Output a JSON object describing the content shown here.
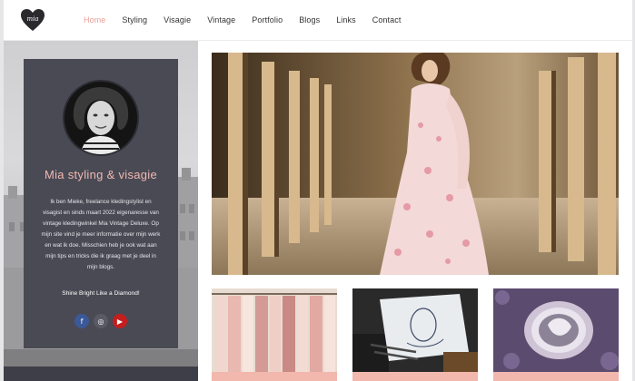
{
  "site": {
    "logo_text": "mia",
    "logo_icon": "heart-logo-icon"
  },
  "nav": {
    "items": [
      {
        "label": "Home",
        "active": true
      },
      {
        "label": "Styling",
        "active": false
      },
      {
        "label": "Visagie",
        "active": false
      },
      {
        "label": "Vintage",
        "active": false
      },
      {
        "label": "Portfolio",
        "active": false
      },
      {
        "label": "Blogs",
        "active": false
      },
      {
        "label": "Links",
        "active": false
      },
      {
        "label": "Contact",
        "active": false
      }
    ]
  },
  "profile": {
    "title": "Mia styling & visagie",
    "bio": "Ik ben Mieke, freelance kledingstylist en visagist en sinds maart 2022 eigenaresse van vintage kledingwinkel Mia Vintage Deluxe. Op mijn site vind je meer informatie over mijn werk en wat ik doe. Misschien heb je ook wat aan mijn tips en tricks die ik graag met je deel in mijn blogs.",
    "motto": "Shine Bright Like a Diamond!",
    "socials": [
      {
        "name": "facebook-icon",
        "glyph": "f"
      },
      {
        "name": "instagram-icon",
        "glyph": "◎"
      },
      {
        "name": "youtube-icon",
        "glyph": "▶"
      }
    ]
  },
  "colors": {
    "accent": "#e9a09a",
    "title_pink": "#f0b8b0",
    "panel": "#4a4a55",
    "thumb_bar": "#f2b7ad"
  }
}
